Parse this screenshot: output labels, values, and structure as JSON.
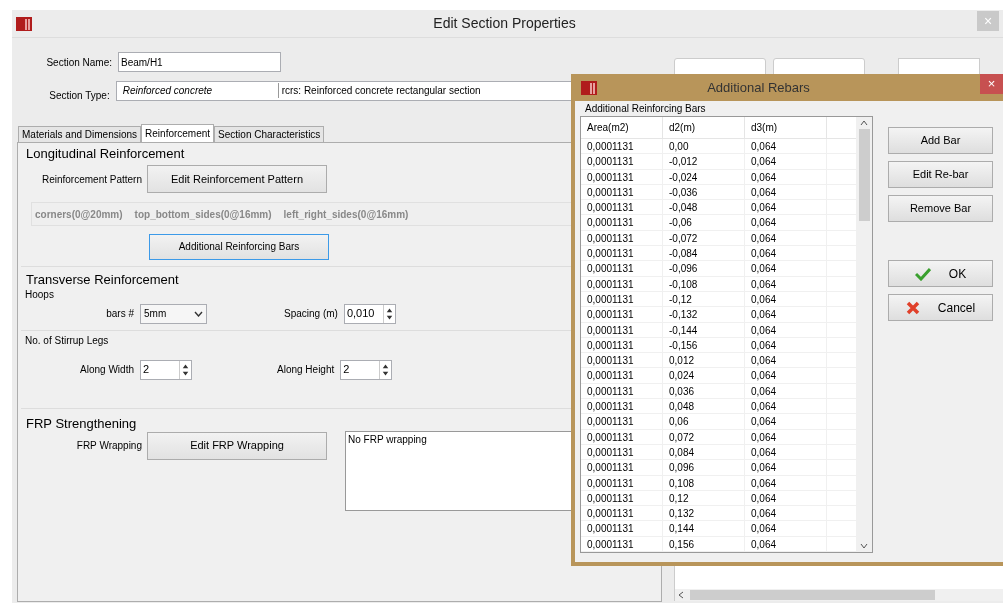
{
  "window": {
    "title": "Edit Section Properties",
    "close": "×"
  },
  "section_name": {
    "label": "Section Name:",
    "value": "Beam/H1"
  },
  "section_type": {
    "label": "Section Type:",
    "material": "Reinforced concrete",
    "description": "rcrs: Reinforced concrete rectangular section"
  },
  "tabs": [
    {
      "label": "Materials and Dimensions",
      "selected": false
    },
    {
      "label": "Reinforcement",
      "selected": true
    },
    {
      "label": "Section Characteristics",
      "selected": false
    }
  ],
  "longitudinal": {
    "title": "Longitudinal Reinforcement",
    "pattern_label": "Reinforcement Pattern",
    "pattern_button": "Edit Reinforcement Pattern",
    "pattern_summary": [
      "corners(0@20mm)",
      "top_bottom_sides(0@16mm)",
      "left_right_sides(0@16mm)"
    ],
    "additional_button": {
      "label": "Additional Reinforcing Bars",
      "focused": true
    }
  },
  "transverse": {
    "title": "Transverse Reinforcement",
    "hoops": {
      "title": "Hoops",
      "bars_label": "bars #",
      "bars_value": "5mm",
      "spacing_label": "Spacing (m)",
      "spacing_value": "0,010"
    },
    "stirrup_legs": {
      "title": "No. of Stirrup Legs",
      "width_label": "Along Width",
      "width_value": "2",
      "height_label": "Along Height",
      "height_value": "2"
    }
  },
  "frp": {
    "title": "FRP Strengthening",
    "label": "FRP Wrapping",
    "button": "Edit FRP Wrapping",
    "text": "No FRP wrapping"
  },
  "dialog": {
    "title": "Additional Rebars",
    "close": "×",
    "group_title": "Additional Reinforcing Bars",
    "columns": [
      "Area(m2)",
      "d2(m)",
      "d3(m)"
    ],
    "rows": [
      [
        "0,0001131",
        "0,00",
        "0,064"
      ],
      [
        "0,0001131",
        "-0,012",
        "0,064"
      ],
      [
        "0,0001131",
        "-0,024",
        "0,064"
      ],
      [
        "0,0001131",
        "-0,036",
        "0,064"
      ],
      [
        "0,0001131",
        "-0,048",
        "0,064"
      ],
      [
        "0,0001131",
        "-0,06",
        "0,064"
      ],
      [
        "0,0001131",
        "-0,072",
        "0,064"
      ],
      [
        "0,0001131",
        "-0,084",
        "0,064"
      ],
      [
        "0,0001131",
        "-0,096",
        "0,064"
      ],
      [
        "0,0001131",
        "-0,108",
        "0,064"
      ],
      [
        "0,0001131",
        "-0,12",
        "0,064"
      ],
      [
        "0,0001131",
        "-0,132",
        "0,064"
      ],
      [
        "0,0001131",
        "-0,144",
        "0,064"
      ],
      [
        "0,0001131",
        "-0,156",
        "0,064"
      ],
      [
        "0,0001131",
        "0,012",
        "0,064"
      ],
      [
        "0,0001131",
        "0,024",
        "0,064"
      ],
      [
        "0,0001131",
        "0,036",
        "0,064"
      ],
      [
        "0,0001131",
        "0,048",
        "0,064"
      ],
      [
        "0,0001131",
        "0,06",
        "0,064"
      ],
      [
        "0,0001131",
        "0,072",
        "0,064"
      ],
      [
        "0,0001131",
        "0,084",
        "0,064"
      ],
      [
        "0,0001131",
        "0,096",
        "0,064"
      ],
      [
        "0,0001131",
        "0,108",
        "0,064"
      ],
      [
        "0,0001131",
        "0,12",
        "0,064"
      ],
      [
        "0,0001131",
        "0,132",
        "0,064"
      ],
      [
        "0,0001131",
        "0,144",
        "0,064"
      ],
      [
        "0,0001131",
        "0,156",
        "0,064"
      ]
    ],
    "buttons": [
      {
        "label": "Add Bar",
        "kind": "plain"
      },
      {
        "label": "Edit Re-bar",
        "kind": "plain"
      },
      {
        "label": "Remove Bar",
        "kind": "plain"
      },
      {
        "label": "OK",
        "kind": "ok"
      },
      {
        "label": "Cancel",
        "kind": "cancel"
      }
    ]
  }
}
